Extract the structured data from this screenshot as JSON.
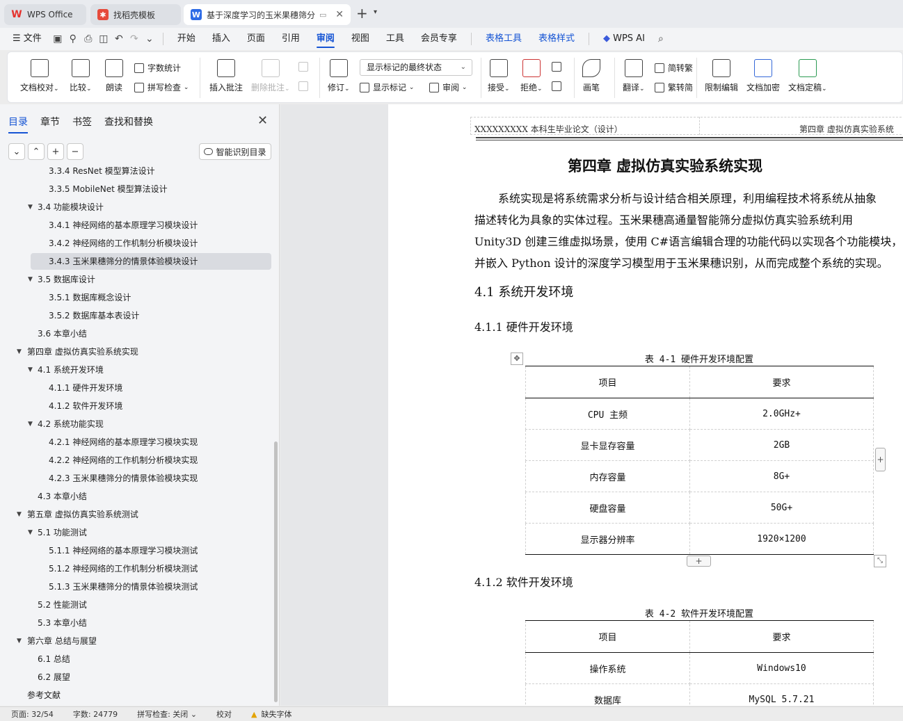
{
  "tabs": [
    {
      "label": "WPS Office",
      "icon": "wps-logo-icon"
    },
    {
      "label": "找稻壳模板",
      "icon": "daoke-icon"
    },
    {
      "label": "基于深度学习的玉米果穗筛分",
      "icon": "writer-doc-icon"
    }
  ],
  "menubar": {
    "file": "文件",
    "items": [
      "开始",
      "插入",
      "页面",
      "引用",
      "审阅",
      "视图",
      "工具",
      "会员专享"
    ],
    "tools": [
      "表格工具",
      "表格样式"
    ],
    "ai": "WPS AI"
  },
  "ribbon": {
    "doc_check": "文档校对",
    "compare": "比较",
    "read_aloud": "朗读",
    "word_count": "字数统计",
    "spell_check": "拼写检查",
    "insert_comment": "插入批注",
    "delete_comment": "删除批注",
    "revise": "修订",
    "markup_state": "显示标记的最终状态",
    "show_markup": "显示标记",
    "review": "审阅",
    "accept": "接受",
    "reject": "拒绝",
    "pen": "画笔",
    "translate": "翻译",
    "to_traditional": "简转繁",
    "to_simplified": "繁转简",
    "restrict_edit": "限制编辑",
    "encrypt": "文档加密",
    "finalize": "文档定稿"
  },
  "nav": {
    "tabs": [
      "目录",
      "章节",
      "书签",
      "查找和替换"
    ],
    "smart_btn": "智能识别目录",
    "toc": [
      {
        "label": "3.3.4 ResNet 模型算法设计",
        "level": 3
      },
      {
        "label": "3.3.5 MobileNet 模型算法设计",
        "level": 3
      },
      {
        "label": "3.4 功能模块设计",
        "level": 2,
        "expanded": true
      },
      {
        "label": "3.4.1 神经网络的基本原理学习模块设计",
        "level": 3
      },
      {
        "label": "3.4.2 神经网络的工作机制分析模块设计",
        "level": 3
      },
      {
        "label": "3.4.3 玉米果穗筛分的情景体验模块设计",
        "level": 3,
        "selected": true
      },
      {
        "label": "3.5 数据库设计",
        "level": 2,
        "expanded": true
      },
      {
        "label": "3.5.1 数据库概念设计",
        "level": 3
      },
      {
        "label": "3.5.2 数据库基本表设计",
        "level": 3
      },
      {
        "label": "3.6 本章小结",
        "level": 2
      },
      {
        "label": "第四章  虚拟仿真实验系统实现",
        "level": 1,
        "expanded": true
      },
      {
        "label": "4.1 系统开发环境",
        "level": 2,
        "expanded": true
      },
      {
        "label": "4.1.1 硬件开发环境",
        "level": 3
      },
      {
        "label": "4.1.2 软件开发环境",
        "level": 3
      },
      {
        "label": "4.2 系统功能实现",
        "level": 2,
        "expanded": true
      },
      {
        "label": "4.2.1 神经网络的基本原理学习模块实现",
        "level": 3
      },
      {
        "label": "4.2.2 神经网络的工作机制分析模块实现",
        "level": 3
      },
      {
        "label": "4.2.3 玉米果穗筛分的情景体验模块实现",
        "level": 3
      },
      {
        "label": "4.3 本章小结",
        "level": 2
      },
      {
        "label": "第五章  虚拟仿真实验系统测试",
        "level": 1,
        "expanded": true
      },
      {
        "label": "5.1 功能测试",
        "level": 2,
        "expanded": true
      },
      {
        "label": "5.1.1 神经网络的基本原理学习模块测试",
        "level": 3
      },
      {
        "label": "5.1.2 神经网络的工作机制分析模块测试",
        "level": 3
      },
      {
        "label": "5.1.3 玉米果穗筛分的情景体验模块测试",
        "level": 3
      },
      {
        "label": "5.2 性能测试",
        "level": 2
      },
      {
        "label": "5.3 本章小结",
        "level": 2
      },
      {
        "label": "第六章  总结与展望",
        "level": 1,
        "expanded": true
      },
      {
        "label": "6.1 总结",
        "level": 2
      },
      {
        "label": "6.2 展望",
        "level": 2
      },
      {
        "label": "参考文献",
        "level": 1
      }
    ]
  },
  "doc": {
    "header_left": "XXXXXXXXX 本科生毕业论文（设计）",
    "header_right": "第四章  虚拟仿真实验系统",
    "chapter_title": "第四章  虚拟仿真实验系统实现",
    "paragraph": [
      "系统实现是将系统需求分析与设计结合相关原理，利用编程技术将系统从抽象",
      "描述转化为具象的实体过程。玉米果穗高通量智能筛分虚拟仿真实验系统利用",
      "Unity3D 创建三维虚拟场景，使用 C#语言编辑合理的功能代码以实现各个功能模块，",
      "并嵌入 Python 设计的深度学习模型用于玉米果穗识别，从而完成整个系统的实现。"
    ],
    "h2_1": "4.1 系统开发环境",
    "h3_1": "4.1.1 硬件开发环境",
    "table1_caption": "表 4-1  硬件开发环境配置",
    "table1_headers": [
      "项目",
      "要求"
    ],
    "table1_rows": [
      [
        "CPU 主频",
        "2.0GHz+"
      ],
      [
        "显卡显存容量",
        "2GB"
      ],
      [
        "内存容量",
        "8G+"
      ],
      [
        "硬盘容量",
        "50G+"
      ],
      [
        "显示器分辨率",
        "1920×1200"
      ]
    ],
    "h3_2": "4.1.2 软件开发环境",
    "table2_caption": "表 4-2  软件开发环境配置",
    "table2_headers": [
      "项目",
      "要求"
    ],
    "table2_rows": [
      [
        "操作系统",
        "Windows10"
      ],
      [
        "数据库",
        "MySQL 5.7.21"
      ]
    ]
  },
  "status": {
    "page": "页面: 32/54",
    "words": "字数: 24779",
    "spell": "拼写检查: 关闭",
    "proof": "校对",
    "missing_font": "缺失字体"
  }
}
